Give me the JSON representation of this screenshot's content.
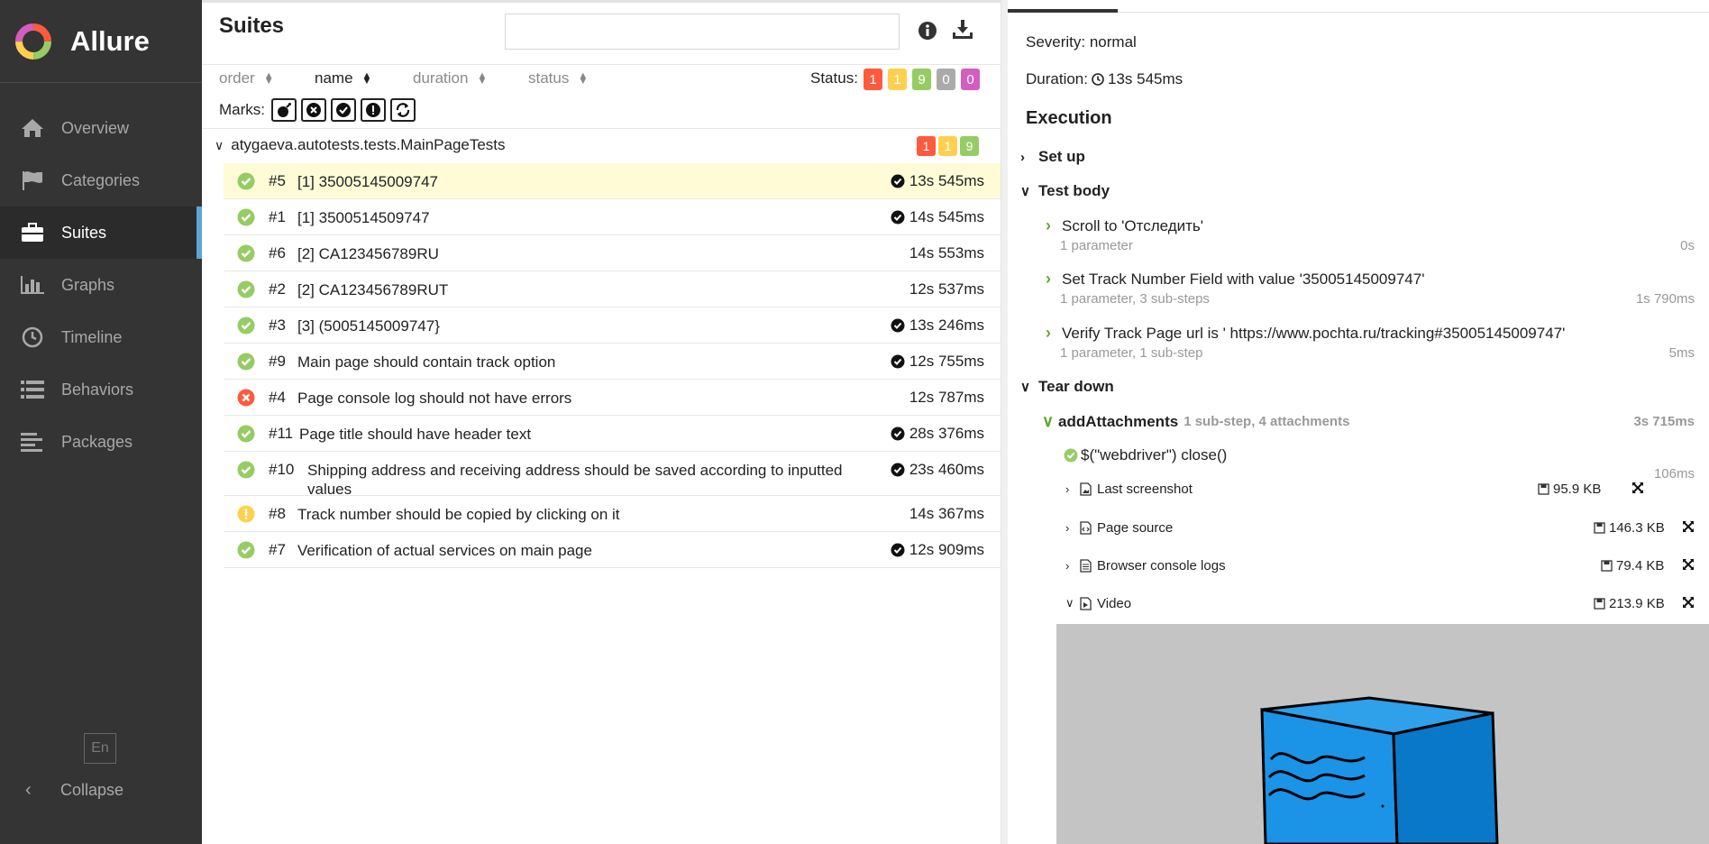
{
  "app": {
    "name": "Allure"
  },
  "sidebar": {
    "items": [
      {
        "label": "Overview",
        "icon": "home-icon"
      },
      {
        "label": "Categories",
        "icon": "flag-icon"
      },
      {
        "label": "Suites",
        "icon": "briefcase-icon"
      },
      {
        "label": "Graphs",
        "icon": "bar-chart-icon"
      },
      {
        "label": "Timeline",
        "icon": "clock-icon"
      },
      {
        "label": "Behaviors",
        "icon": "list-icon"
      },
      {
        "label": "Packages",
        "icon": "align-left-icon"
      }
    ],
    "active": "Suites",
    "lang": "En",
    "collapse": "Collapse"
  },
  "suites": {
    "title": "Suites",
    "search": {
      "value": "",
      "placeholder": ""
    },
    "sort": [
      "order",
      "name",
      "duration",
      "status"
    ],
    "sort_active": "name",
    "status_label": "Status:",
    "status_counts": [
      {
        "value": "1",
        "color": "#fd5a3e"
      },
      {
        "value": "1",
        "color": "#ffd050"
      },
      {
        "value": "9",
        "color": "#97cc64"
      },
      {
        "value": "0",
        "color": "#aaaaaa"
      },
      {
        "value": "0",
        "color": "#d35ebe"
      }
    ],
    "marks_label": "Marks:",
    "marks": [
      "flaky-bomb-icon",
      "new-failed-icon",
      "new-passed-icon",
      "new-broken-icon",
      "retries-icon"
    ],
    "group": {
      "name": "atygaeva.autotests.tests.MainPageTests",
      "counts": [
        "1",
        "1",
        "9"
      ]
    },
    "rows": [
      {
        "status": "passed",
        "num": "#5",
        "name": "[1] 35005145009747",
        "duration": "13s 545ms",
        "check": true,
        "selected": true
      },
      {
        "status": "passed",
        "num": "#1",
        "name": "[1] 3500514509747",
        "duration": "14s 545ms",
        "check": true
      },
      {
        "status": "passed",
        "num": "#6",
        "name": "[2] CA123456789RU",
        "duration": "14s 553ms",
        "check": false
      },
      {
        "status": "passed",
        "num": "#2",
        "name": "[2] CA123456789RUT",
        "duration": "12s 537ms",
        "check": false
      },
      {
        "status": "passed",
        "num": "#3",
        "name": "[3] (5005145009747}",
        "duration": "13s 246ms",
        "check": true
      },
      {
        "status": "passed",
        "num": "#9",
        "name": "Main page should contain track option",
        "duration": "12s 755ms",
        "check": true
      },
      {
        "status": "failed",
        "num": "#4",
        "name": "Page console log should not have errors",
        "duration": "12s 787ms",
        "check": false
      },
      {
        "status": "passed",
        "num": "#11",
        "name": "Page title should have header text",
        "duration": "28s 376ms",
        "check": true
      },
      {
        "status": "passed",
        "num": "#10",
        "name": "Shipping address and receiving address should be saved according to inputted values",
        "duration": "23s 460ms",
        "check": true
      },
      {
        "status": "broken",
        "num": "#8",
        "name": "Track number should be copied by clicking on it",
        "duration": "14s 367ms",
        "check": false
      },
      {
        "status": "passed",
        "num": "#7",
        "name": "Verification of actual services on main page",
        "duration": "12s 909ms",
        "check": true
      }
    ]
  },
  "details": {
    "severity": "Severity: normal",
    "duration_label": "Duration:",
    "duration": "13s 545ms",
    "execution": "Execution",
    "setup": "Set up",
    "testbody": "Test body",
    "steps": [
      {
        "name": "Scroll to 'Отследить'",
        "sub": "1 parameter",
        "time": "0s"
      },
      {
        "name": "Set Track Number Field with value '35005145009747'",
        "sub": "1 parameter, 3 sub-steps",
        "time": "1s 790ms"
      },
      {
        "name": "Verify Track Page url is ' https://www.pochta.ru/tracking#35005145009747'",
        "sub": "1 parameter, 1 sub-step",
        "time": "5ms"
      }
    ],
    "teardown": "Tear down",
    "teardown_step": {
      "name": "addAttachments",
      "meta": "1 sub-step, 4 attachments",
      "time": "3s 715ms"
    },
    "substep": {
      "name": "$(\"webdriver\") close()",
      "time": "106ms"
    },
    "attachments": [
      {
        "name": "Last screenshot",
        "size": "95.9 KB",
        "type": "image",
        "expanded": false
      },
      {
        "name": "Page source",
        "size": "146.3 KB",
        "type": "code",
        "expanded": false
      },
      {
        "name": "Browser console logs",
        "size": "79.4 KB",
        "type": "text",
        "expanded": false
      },
      {
        "name": "Video",
        "size": "213.9 KB",
        "type": "video",
        "expanded": true
      }
    ]
  }
}
